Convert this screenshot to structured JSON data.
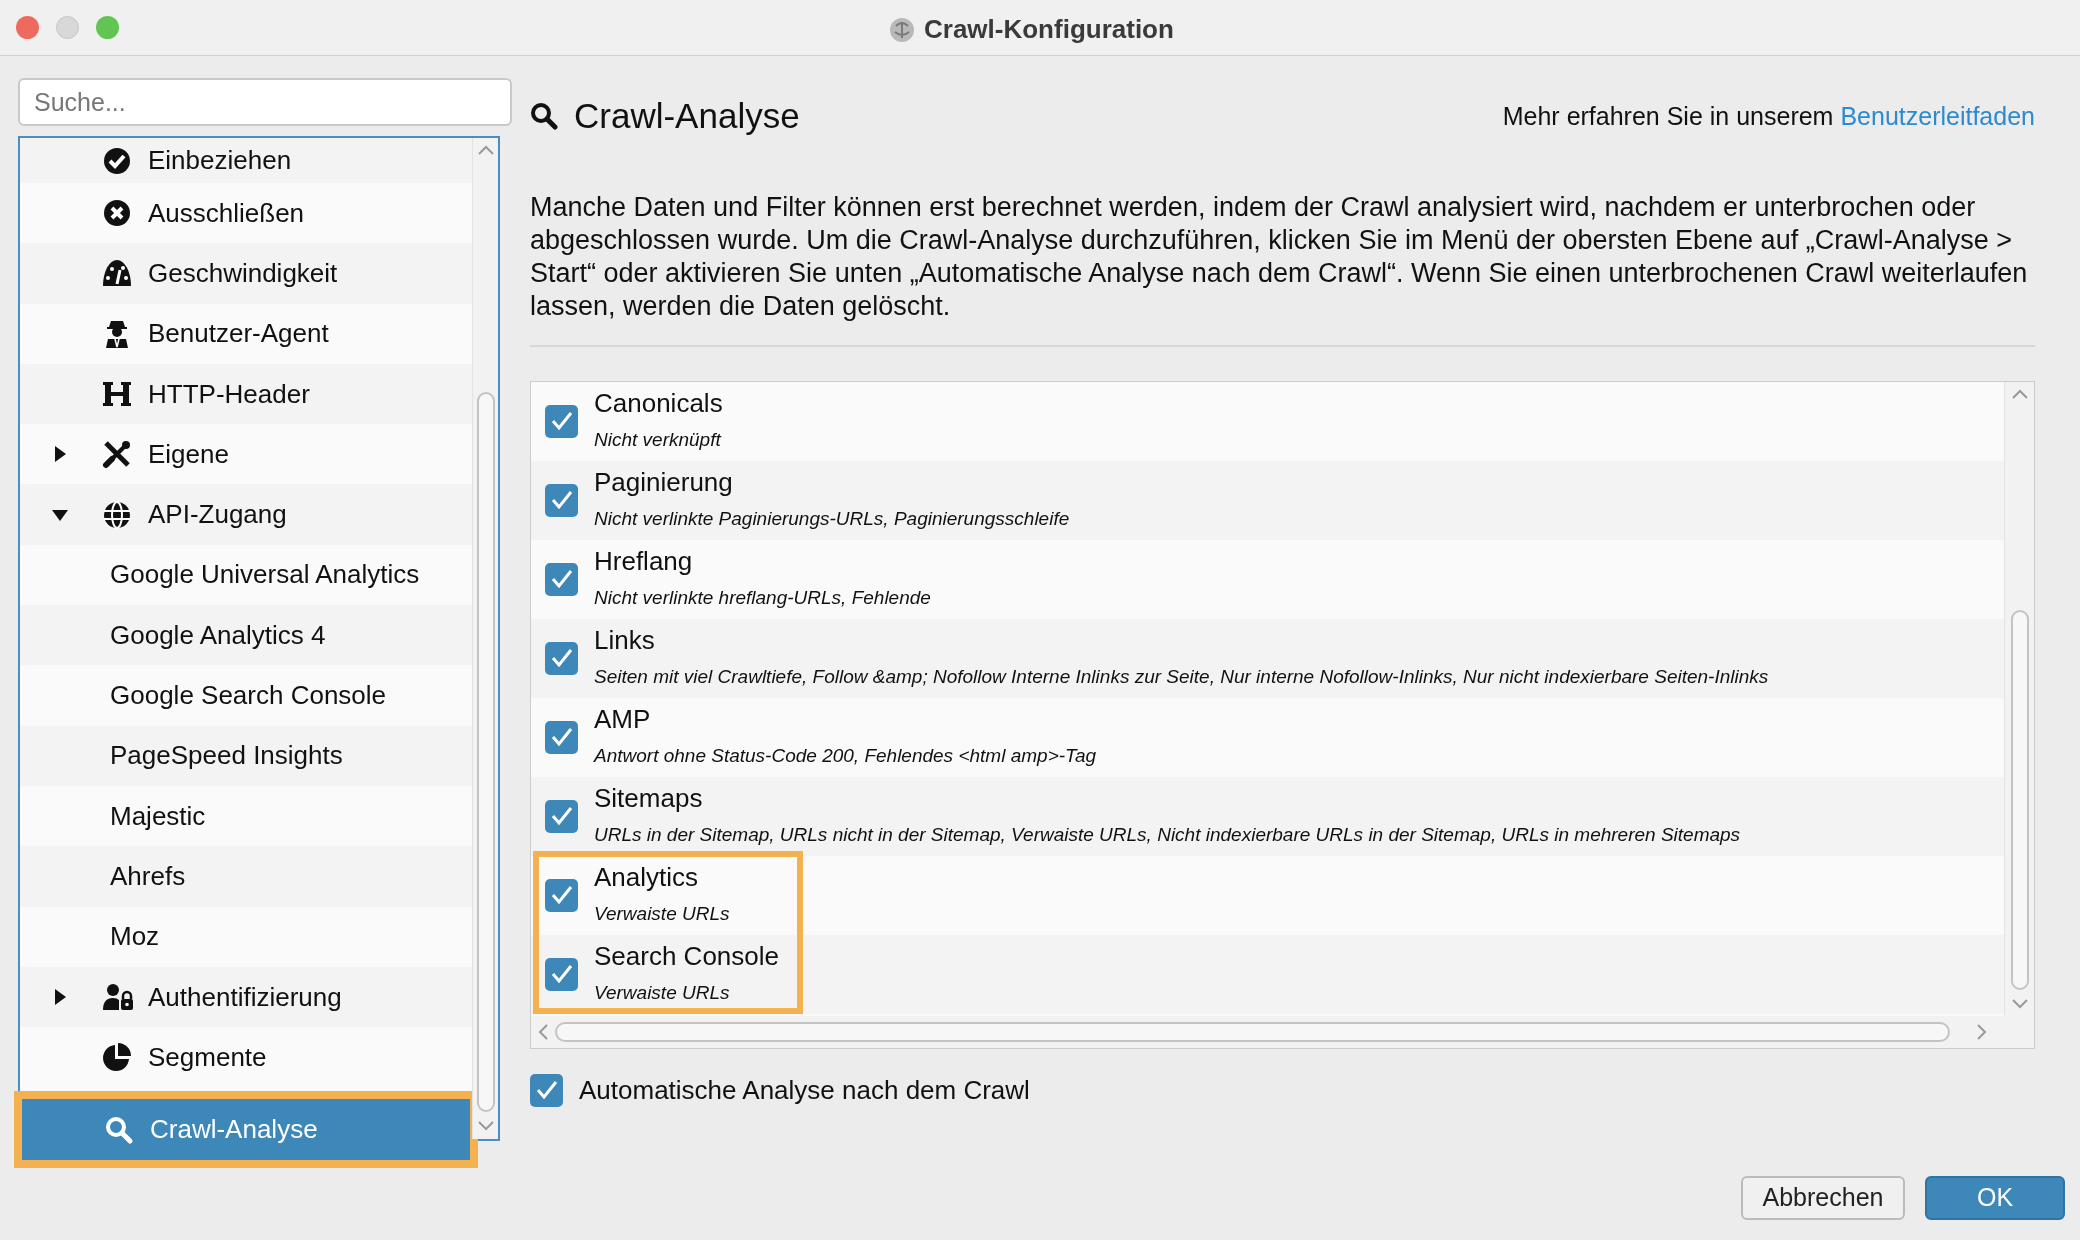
{
  "window": {
    "title": "Crawl-Konfiguration"
  },
  "sidebar": {
    "search": {
      "placeholder": "Suche..."
    },
    "items": [
      {
        "label": "Einbeziehen",
        "selected": false,
        "highlighted": false
      },
      {
        "label": "Ausschließen",
        "selected": false,
        "highlighted": false
      },
      {
        "label": "Geschwindigkeit",
        "selected": false,
        "highlighted": false
      },
      {
        "label": "Benutzer-Agent",
        "selected": false,
        "highlighted": false
      },
      {
        "label": "HTTP-Header",
        "selected": false,
        "highlighted": false
      },
      {
        "label": "Eigene",
        "selected": false,
        "highlighted": false,
        "expanded": false
      },
      {
        "label": "API-Zugang",
        "selected": false,
        "highlighted": false,
        "expanded": true,
        "children": [
          {
            "label": "Google Universal Analytics",
            "selected": false,
            "highlighted": false
          },
          {
            "label": "Google Analytics 4",
            "selected": false,
            "highlighted": false
          },
          {
            "label": "Google Search Console",
            "selected": false,
            "highlighted": false
          },
          {
            "label": "PageSpeed Insights",
            "selected": false,
            "highlighted": false
          },
          {
            "label": "Majestic",
            "selected": false,
            "highlighted": false
          },
          {
            "label": "Ahrefs",
            "selected": false,
            "highlighted": false
          },
          {
            "label": "Moz",
            "selected": false,
            "highlighted": false
          }
        ]
      },
      {
        "label": "Authentifizierung",
        "selected": false,
        "highlighted": false,
        "expanded": false
      },
      {
        "label": "Segmente",
        "selected": false,
        "highlighted": false
      },
      {
        "label": "Crawl-Analyse",
        "selected": true,
        "highlighted": true
      }
    ]
  },
  "panel": {
    "title": "Crawl-Analyse",
    "help_text": "Mehr erfahren Sie in unserem",
    "help_link": "Benutzerleitfaden",
    "description": "Manche Daten und Filter können erst berechnet werden, indem der Crawl analysiert wird, nachdem er unterbrochen oder abgeschlossen wurde. Um die Crawl-Analyse durchzuführen, klicken Sie im Menü der obersten Ebene auf „Crawl-Analyse > Start“ oder aktivieren Sie unten „Automatische Analyse nach dem Crawl“. Wenn Sie einen unterbrochenen Crawl weiterlaufen lassen, werden die Daten gelöscht.",
    "checks": [
      {
        "label": "Canonicals",
        "detail": "Nicht verknüpft",
        "checked": true,
        "highlighted": false
      },
      {
        "label": "Paginierung",
        "detail": "Nicht verlinkte Paginierungs-URLs, Paginierungsschleife",
        "checked": true,
        "highlighted": false
      },
      {
        "label": "Hreflang",
        "detail": "Nicht verlinkte hreflang-URLs, Fehlende",
        "checked": true,
        "highlighted": false
      },
      {
        "label": "Links",
        "detail": "Seiten mit viel Crawltiefe, Follow &amp; Nofollow Interne Inlinks zur Seite, Nur interne Nofollow-Inlinks, Nur nicht indexierbare Seiten-Inlinks",
        "checked": true,
        "highlighted": false
      },
      {
        "label": "AMP",
        "detail": "Antwort ohne Status-Code 200, Fehlendes <html amp>-Tag",
        "checked": true,
        "highlighted": false
      },
      {
        "label": "Sitemaps",
        "detail": "URLs in der Sitemap, URLs nicht in der Sitemap, Verwaiste URLs, Nicht indexierbare URLs in der Sitemap, URLs in mehreren Sitemaps",
        "checked": true,
        "highlighted": false
      },
      {
        "label": "Analytics",
        "detail": "Verwaiste URLs",
        "checked": true,
        "highlighted": true
      },
      {
        "label": "Search Console",
        "detail": "Verwaiste URLs",
        "checked": true,
        "highlighted": true
      }
    ],
    "auto_analysis": {
      "label": "Automatische Analyse nach dem Crawl",
      "checked": true
    }
  },
  "buttons": [
    {
      "label": "Abbrechen",
      "kind": "secondary"
    },
    {
      "label": "OK",
      "kind": "primary"
    }
  ]
}
